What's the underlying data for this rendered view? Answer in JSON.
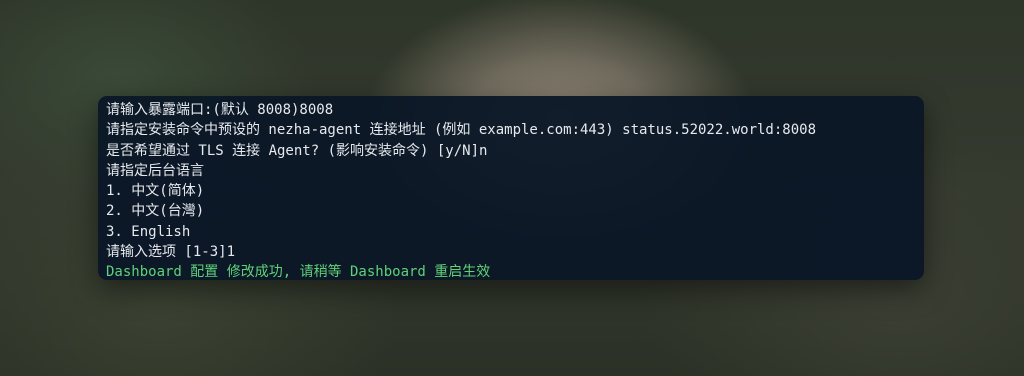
{
  "terminal": {
    "lines": [
      {
        "text": "请输入暴露端口:(默认 8008)8008",
        "type": "normal"
      },
      {
        "text": "请指定安装命令中预设的 nezha-agent 连接地址 (例如 example.com:443) status.52022.world:8008",
        "type": "normal"
      },
      {
        "text": "是否希望通过 TLS 连接 Agent? (影响安装命令) [y/N]n",
        "type": "normal"
      },
      {
        "text": "请指定后台语言",
        "type": "normal"
      },
      {
        "text": "1. 中文(简体)",
        "type": "normal"
      },
      {
        "text": "2. 中文(台灣)",
        "type": "normal"
      },
      {
        "text": "3. English",
        "type": "normal"
      },
      {
        "text": "请输入选项 [1-3]1",
        "type": "normal"
      },
      {
        "text": "Dashboard 配置 修改成功, 请稍等 Dashboard 重启生效",
        "type": "success"
      }
    ]
  },
  "colors": {
    "terminal_background": "#0a1626",
    "text": "#e6e9ee",
    "success_text": "#5fd17a"
  }
}
